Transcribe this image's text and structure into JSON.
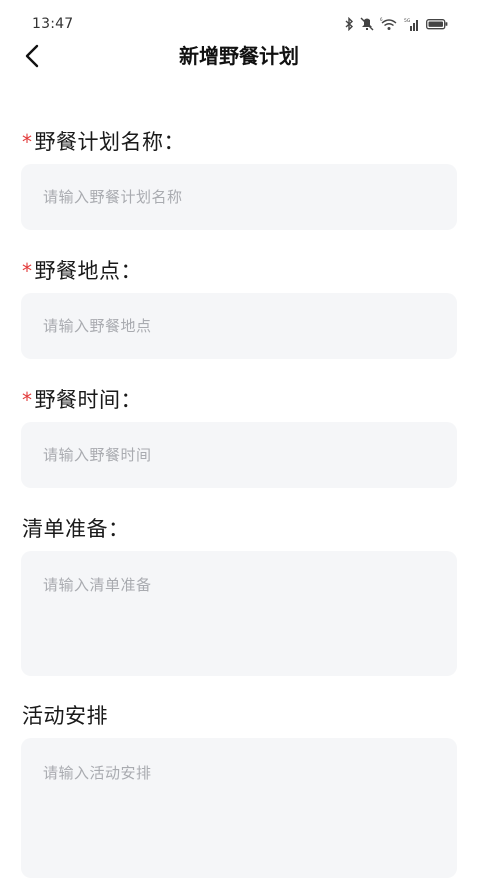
{
  "status_bar": {
    "time": "13:47",
    "icons": [
      "bluetooth-icon",
      "mute-icon",
      "wifi-icon",
      "signal-icon",
      "battery-icon"
    ]
  },
  "nav": {
    "back_icon": "chevron-left-icon",
    "title": "新增野餐计划"
  },
  "form": {
    "fields": [
      {
        "required": true,
        "required_mark": "*",
        "label": "野餐计划名称：",
        "placeholder": "请输入野餐计划名称"
      },
      {
        "required": true,
        "required_mark": "*",
        "label": "野餐地点：",
        "placeholder": "请输入野餐地点"
      },
      {
        "required": true,
        "required_mark": "*",
        "label": "野餐时间：",
        "placeholder": "请输入野餐时间"
      },
      {
        "required": false,
        "label": "清单准备：",
        "placeholder": "请输入清单准备"
      },
      {
        "required": false,
        "label": "活动安排",
        "placeholder": "请输入活动安排"
      }
    ]
  },
  "colors": {
    "required_mark": "#e23b3b",
    "input_background": "#f5f6f8",
    "placeholder_text": "#a9abb0"
  }
}
